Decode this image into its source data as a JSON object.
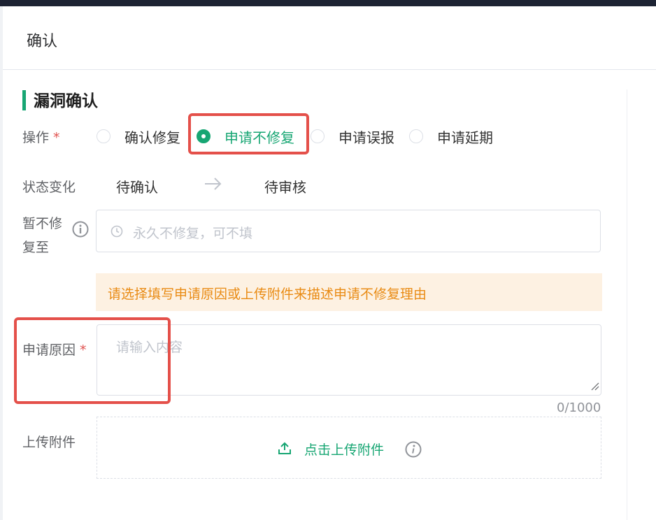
{
  "dialog": {
    "title": "确认"
  },
  "section": {
    "title": "漏洞确认"
  },
  "operation": {
    "label": "操作",
    "required_mark": "*",
    "options": [
      {
        "label": "确认修复",
        "checked": false
      },
      {
        "label": "申请不修复",
        "checked": true
      },
      {
        "label": "申请误报",
        "checked": false
      },
      {
        "label": "申请延期",
        "checked": false
      }
    ]
  },
  "status_change": {
    "label": "状态变化",
    "from": "待确认",
    "to": "待审核",
    "arrow_icon": "arrow-right-icon"
  },
  "defer_until": {
    "label_line1": "暂不修",
    "label_line2": "复至",
    "info_icon": "info-icon",
    "placeholder": "永久不修复，可不填",
    "icon": "clock-icon"
  },
  "notice": {
    "text": "请选择填写申请原因或上传附件来描述申请不修复理由"
  },
  "reason": {
    "label": "申请原因",
    "required_mark": "*",
    "placeholder": "请输入内容",
    "counter": "0/1000"
  },
  "attachment": {
    "label": "上传附件",
    "button_label": "点击上传附件",
    "upload_icon": "upload-icon",
    "info_icon": "info-icon"
  },
  "colors": {
    "accent": "#17a673",
    "warning": "#e98b14",
    "highlight": "#e4504a",
    "required": "#e0524f"
  }
}
